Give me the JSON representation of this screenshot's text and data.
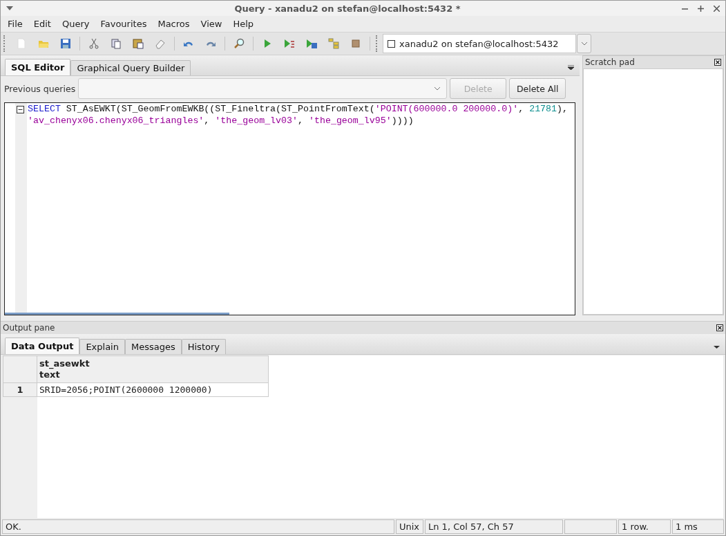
{
  "window": {
    "title": "Query - xanadu2 on stefan@localhost:5432 *"
  },
  "menu": [
    "File",
    "Edit",
    "Query",
    "Favourites",
    "Macros",
    "View",
    "Help"
  ],
  "toolbar": [
    {
      "kind": "new"
    },
    {
      "kind": "open"
    },
    {
      "kind": "save"
    },
    {
      "kind": "sep"
    },
    {
      "kind": "cut"
    },
    {
      "kind": "copy"
    },
    {
      "kind": "paste"
    },
    {
      "kind": "clear"
    },
    {
      "kind": "sep"
    },
    {
      "kind": "undo"
    },
    {
      "kind": "redo"
    },
    {
      "kind": "sep"
    },
    {
      "kind": "find"
    },
    {
      "kind": "sep"
    },
    {
      "kind": "run"
    },
    {
      "kind": "explain"
    },
    {
      "kind": "runfile"
    },
    {
      "kind": "tree"
    },
    {
      "kind": "stop"
    },
    {
      "kind": "sep"
    }
  ],
  "connection": {
    "value": "xanadu2 on stefan@localhost:5432"
  },
  "editor_tabs": [
    {
      "label": "SQL Editor",
      "selected": true
    },
    {
      "label": "Graphical Query Builder",
      "selected": false
    }
  ],
  "previous_queries": {
    "label": "Previous queries",
    "buttons": [
      {
        "label": "Delete",
        "disabled": true
      },
      {
        "label": "Delete All",
        "disabled": false
      }
    ]
  },
  "code_lines": [
    [
      {
        "kind": "keyword",
        "text": "SELECT"
      },
      {
        "kind": "plain",
        "text": " ST_AsEWKT(ST_GeomFromEWKB((ST_Fineltra(ST_PointFromText("
      },
      {
        "kind": "string",
        "text": "'POINT(600000.0 200000.0)'"
      },
      {
        "kind": "plain",
        "text": ", "
      },
      {
        "kind": "number",
        "text": "21781"
      },
      {
        "kind": "plain",
        "text": "),"
      }
    ],
    [
      {
        "kind": "string",
        "text": "'av_chenyx06.chenyx06_triangles'"
      },
      {
        "kind": "plain",
        "text": ", "
      },
      {
        "kind": "string",
        "text": "'the_geom_lv03'"
      },
      {
        "kind": "plain",
        "text": ", "
      },
      {
        "kind": "string",
        "text": "'the_geom_lv95'"
      },
      {
        "kind": "plain",
        "text": "))))"
      }
    ]
  ],
  "scratch_pad": {
    "title": "Scratch pad"
  },
  "output_pane": {
    "title": "Output pane",
    "tabs": [
      {
        "label": "Data Output",
        "selected": true
      },
      {
        "label": "Explain",
        "selected": false
      },
      {
        "label": "Messages",
        "selected": false
      },
      {
        "label": "History",
        "selected": false
      }
    ],
    "table": {
      "columns": [
        {
          "name": "st_asewkt",
          "type": "text"
        }
      ],
      "rows": [
        {
          "number": "1",
          "cells": [
            "SRID=2056;POINT(2600000 1200000)"
          ]
        }
      ]
    }
  },
  "status_bar": [
    "OK.",
    "Unix",
    "Ln 1, Col 57, Ch 57",
    "1 row.",
    "1 ms"
  ]
}
